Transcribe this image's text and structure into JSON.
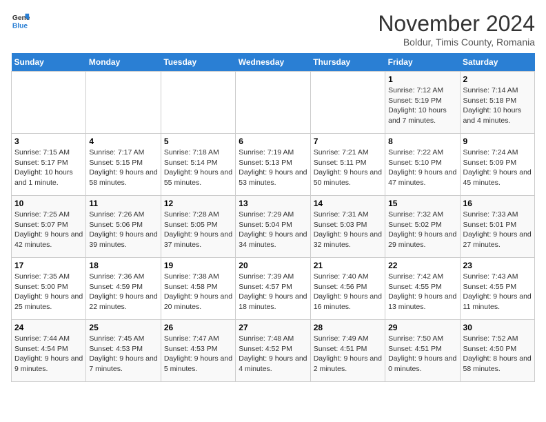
{
  "header": {
    "logo_line1": "General",
    "logo_line2": "Blue",
    "month_year": "November 2024",
    "location": "Boldur, Timis County, Romania"
  },
  "days_of_week": [
    "Sunday",
    "Monday",
    "Tuesday",
    "Wednesday",
    "Thursday",
    "Friday",
    "Saturday"
  ],
  "weeks": [
    [
      {
        "num": "",
        "info": ""
      },
      {
        "num": "",
        "info": ""
      },
      {
        "num": "",
        "info": ""
      },
      {
        "num": "",
        "info": ""
      },
      {
        "num": "",
        "info": ""
      },
      {
        "num": "1",
        "info": "Sunrise: 7:12 AM\nSunset: 5:19 PM\nDaylight: 10 hours and 7 minutes."
      },
      {
        "num": "2",
        "info": "Sunrise: 7:14 AM\nSunset: 5:18 PM\nDaylight: 10 hours and 4 minutes."
      }
    ],
    [
      {
        "num": "3",
        "info": "Sunrise: 7:15 AM\nSunset: 5:17 PM\nDaylight: 10 hours and 1 minute."
      },
      {
        "num": "4",
        "info": "Sunrise: 7:17 AM\nSunset: 5:15 PM\nDaylight: 9 hours and 58 minutes."
      },
      {
        "num": "5",
        "info": "Sunrise: 7:18 AM\nSunset: 5:14 PM\nDaylight: 9 hours and 55 minutes."
      },
      {
        "num": "6",
        "info": "Sunrise: 7:19 AM\nSunset: 5:13 PM\nDaylight: 9 hours and 53 minutes."
      },
      {
        "num": "7",
        "info": "Sunrise: 7:21 AM\nSunset: 5:11 PM\nDaylight: 9 hours and 50 minutes."
      },
      {
        "num": "8",
        "info": "Sunrise: 7:22 AM\nSunset: 5:10 PM\nDaylight: 9 hours and 47 minutes."
      },
      {
        "num": "9",
        "info": "Sunrise: 7:24 AM\nSunset: 5:09 PM\nDaylight: 9 hours and 45 minutes."
      }
    ],
    [
      {
        "num": "10",
        "info": "Sunrise: 7:25 AM\nSunset: 5:07 PM\nDaylight: 9 hours and 42 minutes."
      },
      {
        "num": "11",
        "info": "Sunrise: 7:26 AM\nSunset: 5:06 PM\nDaylight: 9 hours and 39 minutes."
      },
      {
        "num": "12",
        "info": "Sunrise: 7:28 AM\nSunset: 5:05 PM\nDaylight: 9 hours and 37 minutes."
      },
      {
        "num": "13",
        "info": "Sunrise: 7:29 AM\nSunset: 5:04 PM\nDaylight: 9 hours and 34 minutes."
      },
      {
        "num": "14",
        "info": "Sunrise: 7:31 AM\nSunset: 5:03 PM\nDaylight: 9 hours and 32 minutes."
      },
      {
        "num": "15",
        "info": "Sunrise: 7:32 AM\nSunset: 5:02 PM\nDaylight: 9 hours and 29 minutes."
      },
      {
        "num": "16",
        "info": "Sunrise: 7:33 AM\nSunset: 5:01 PM\nDaylight: 9 hours and 27 minutes."
      }
    ],
    [
      {
        "num": "17",
        "info": "Sunrise: 7:35 AM\nSunset: 5:00 PM\nDaylight: 9 hours and 25 minutes."
      },
      {
        "num": "18",
        "info": "Sunrise: 7:36 AM\nSunset: 4:59 PM\nDaylight: 9 hours and 22 minutes."
      },
      {
        "num": "19",
        "info": "Sunrise: 7:38 AM\nSunset: 4:58 PM\nDaylight: 9 hours and 20 minutes."
      },
      {
        "num": "20",
        "info": "Sunrise: 7:39 AM\nSunset: 4:57 PM\nDaylight: 9 hours and 18 minutes."
      },
      {
        "num": "21",
        "info": "Sunrise: 7:40 AM\nSunset: 4:56 PM\nDaylight: 9 hours and 16 minutes."
      },
      {
        "num": "22",
        "info": "Sunrise: 7:42 AM\nSunset: 4:55 PM\nDaylight: 9 hours and 13 minutes."
      },
      {
        "num": "23",
        "info": "Sunrise: 7:43 AM\nSunset: 4:55 PM\nDaylight: 9 hours and 11 minutes."
      }
    ],
    [
      {
        "num": "24",
        "info": "Sunrise: 7:44 AM\nSunset: 4:54 PM\nDaylight: 9 hours and 9 minutes."
      },
      {
        "num": "25",
        "info": "Sunrise: 7:45 AM\nSunset: 4:53 PM\nDaylight: 9 hours and 7 minutes."
      },
      {
        "num": "26",
        "info": "Sunrise: 7:47 AM\nSunset: 4:53 PM\nDaylight: 9 hours and 5 minutes."
      },
      {
        "num": "27",
        "info": "Sunrise: 7:48 AM\nSunset: 4:52 PM\nDaylight: 9 hours and 4 minutes."
      },
      {
        "num": "28",
        "info": "Sunrise: 7:49 AM\nSunset: 4:51 PM\nDaylight: 9 hours and 2 minutes."
      },
      {
        "num": "29",
        "info": "Sunrise: 7:50 AM\nSunset: 4:51 PM\nDaylight: 9 hours and 0 minutes."
      },
      {
        "num": "30",
        "info": "Sunrise: 7:52 AM\nSunset: 4:50 PM\nDaylight: 8 hours and 58 minutes."
      }
    ]
  ]
}
